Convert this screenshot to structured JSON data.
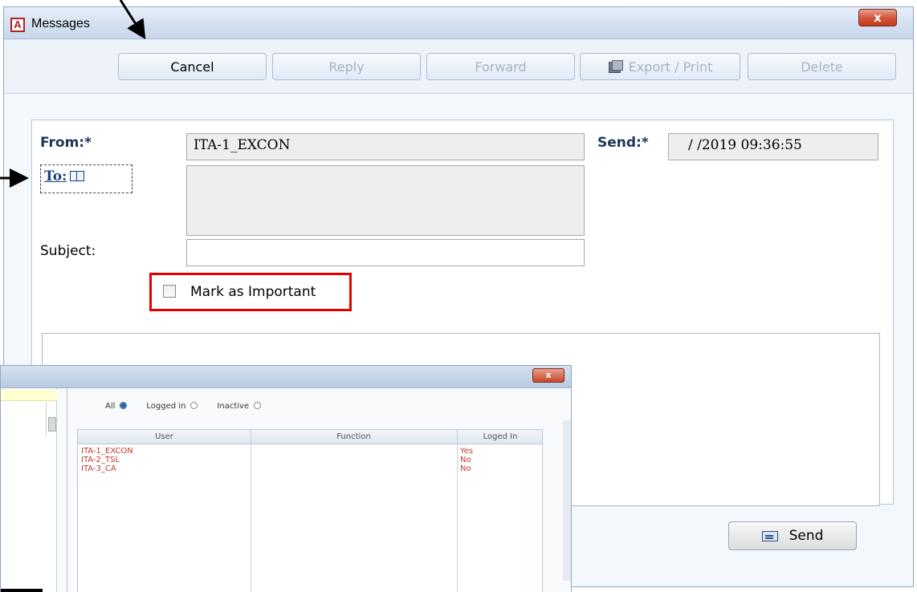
{
  "window": {
    "title": "Messages",
    "app_icon_letter": "A",
    "close_glyph": "x"
  },
  "toolbar": {
    "cancel_label": "Cancel",
    "reply_label": "Reply",
    "forward_label": "Forward",
    "export_label": "Export / Print",
    "delete_label": "Delete"
  },
  "form": {
    "from_label": "From:*",
    "from_value": "ITA-1_EXCON",
    "to_label": "To:",
    "send_label": "Send:*",
    "send_value": "/ /2019 09:36:55",
    "subject_label": "Subject:",
    "subject_value": "",
    "important_label": "Mark as Important",
    "important_checked": false,
    "send_button_label": "Send"
  },
  "picker": {
    "close_glyph": "x",
    "filters": [
      {
        "label": "All",
        "selected": true
      },
      {
        "label": "Logged in",
        "selected": false
      },
      {
        "label": "Inactive",
        "selected": false
      }
    ],
    "columns": [
      "User",
      "Function",
      "Loged In"
    ],
    "rows": [
      {
        "user": "ITA-1_EXCON",
        "function": "",
        "logged_in": "Yes"
      },
      {
        "user": "ITA-2_TSL",
        "function": "",
        "logged_in": "No"
      },
      {
        "user": "ITA-3_CA",
        "function": "",
        "logged_in": "No"
      }
    ]
  },
  "colors": {
    "annotation_highlight": "#e50000",
    "user_row_text": "#c0392b",
    "link_blue": "#1a3f80"
  }
}
